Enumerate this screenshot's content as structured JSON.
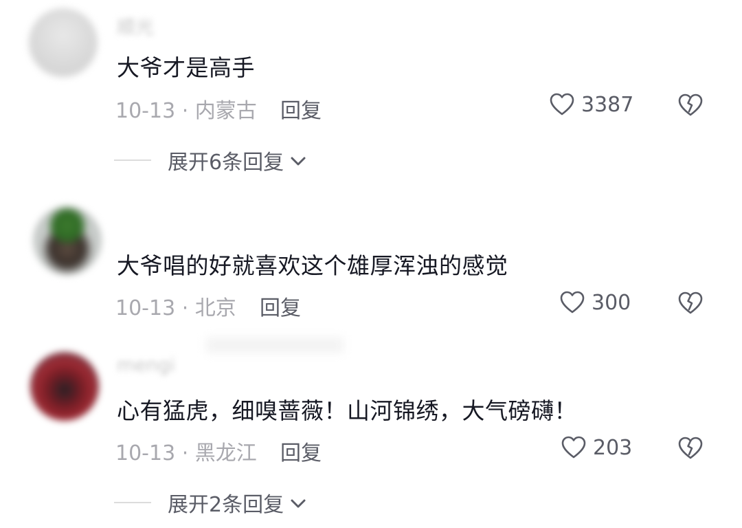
{
  "comments": [
    {
      "username": "顺光",
      "text": "大爷才是高手",
      "date_location": "10-13 · 内蒙古",
      "reply_label": "回复",
      "likes": "3387",
      "expand_label": "展开6条回复"
    },
    {
      "username": "",
      "text": "大爷唱的好就喜欢这个雄厚浑浊的感觉",
      "date_location": "10-13 · 北京",
      "reply_label": "回复",
      "likes": "300"
    },
    {
      "username": "mengi",
      "text": "心有猛虎，细嗅蔷薇！山河锦绣，大气磅礴！",
      "date_location": "10-13 · 黑龙江",
      "reply_label": "回复",
      "likes": "203",
      "expand_label": "展开2条回复"
    }
  ],
  "icons": {
    "like": "heart-outline-icon",
    "dislike": "broken-heart-icon",
    "expand": "chevron-down-icon"
  },
  "colors": {
    "text_primary": "#161823",
    "text_meta": "#a8a8ae",
    "text_action": "#5a5c66"
  }
}
